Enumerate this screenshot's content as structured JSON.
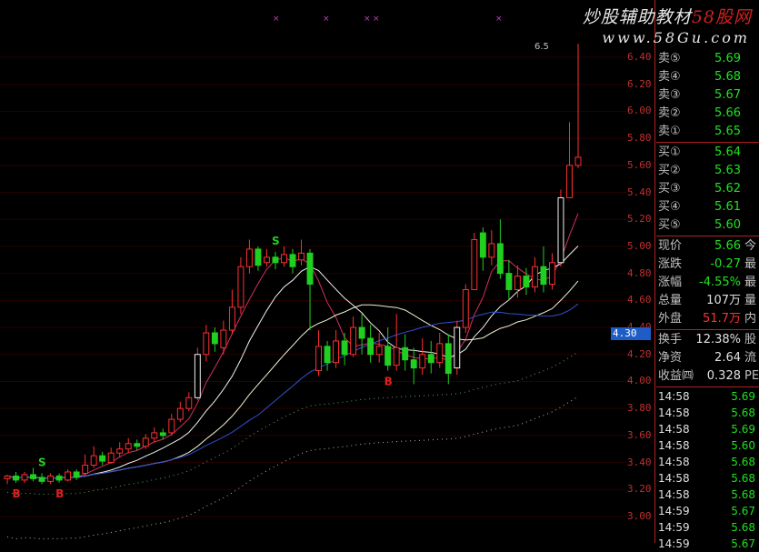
{
  "watermark": {
    "title_a": "炒股辅助教材",
    "title_b": "58股网",
    "url": "www.58Gu.com"
  },
  "peak_label": "6.5",
  "cursor_price": "4.30",
  "price_axis": [
    "6.40",
    "6.20",
    "6.00",
    "5.80",
    "5.60",
    "5.40",
    "5.20",
    "5.00",
    "4.80",
    "4.60",
    "4.40",
    "4.20",
    "4.00",
    "3.80",
    "3.60",
    "3.40",
    "3.20",
    "3.00"
  ],
  "order_book": [
    {
      "label": "卖⑤",
      "value": "5.69",
      "color": "green"
    },
    {
      "label": "卖④",
      "value": "5.68",
      "color": "green"
    },
    {
      "label": "卖③",
      "value": "5.67",
      "color": "green"
    },
    {
      "label": "卖②",
      "value": "5.66",
      "color": "green"
    },
    {
      "label": "卖①",
      "value": "5.65",
      "color": "green"
    },
    {
      "label": "买①",
      "value": "5.64",
      "color": "green"
    },
    {
      "label": "买②",
      "value": "5.63",
      "color": "green"
    },
    {
      "label": "买③",
      "value": "5.62",
      "color": "green"
    },
    {
      "label": "买④",
      "value": "5.61",
      "color": "green"
    },
    {
      "label": "买⑤",
      "value": "5.60",
      "color": "green"
    }
  ],
  "quote": [
    {
      "label": "现价",
      "value": "5.66",
      "color": "green",
      "cut": "今"
    },
    {
      "label": "涨跌",
      "value": "-0.27",
      "color": "green",
      "cut": "最"
    },
    {
      "label": "涨幅",
      "value": "-4.55%",
      "color": "green",
      "cut": "最"
    },
    {
      "label": "总量",
      "value": "107万",
      "color": "white",
      "cut": "量"
    },
    {
      "label": "外盘",
      "value": "51.7万",
      "color": "red",
      "cut": "内"
    }
  ],
  "stats": [
    {
      "label": "换手",
      "value": "12.38%",
      "color": "white",
      "cut": "股"
    },
    {
      "label": "净资",
      "value": "2.64",
      "color": "white",
      "cut": "流"
    },
    {
      "label": "收益㈣",
      "value": "0.328",
      "color": "white",
      "cut": "PE"
    }
  ],
  "ticks": [
    {
      "time": "14:58",
      "price": "5.69"
    },
    {
      "time": "14:58",
      "price": "5.68"
    },
    {
      "time": "14:58",
      "price": "5.69"
    },
    {
      "time": "14:58",
      "price": "5.60"
    },
    {
      "time": "14:58",
      "price": "5.68"
    },
    {
      "time": "14:58",
      "price": "5.68"
    },
    {
      "time": "14:58",
      "price": "5.68"
    },
    {
      "time": "14:59",
      "price": "5.67"
    },
    {
      "time": "14:59",
      "price": "5.68"
    },
    {
      "time": "14:59",
      "price": "5.67"
    }
  ],
  "signals": [
    {
      "text": "B",
      "color": "#e02020",
      "candle": 1
    },
    {
      "text": "S",
      "color": "#20d020",
      "candle": 4
    },
    {
      "text": "B",
      "color": "#e02020",
      "candle": 6
    },
    {
      "text": "S",
      "color": "#20d020",
      "candle": 31
    },
    {
      "text": "B",
      "color": "#e02020",
      "candle": 44
    }
  ],
  "chart_data": {
    "type": "candlestick",
    "ylim": [
      2.95,
      6.5
    ],
    "candles": [
      [
        3.28,
        3.3,
        3.24,
        3.31
      ],
      [
        3.3,
        3.27,
        3.25,
        3.33
      ],
      [
        3.27,
        3.31,
        3.25,
        3.33
      ],
      [
        3.31,
        3.28,
        3.26,
        3.36
      ],
      [
        3.29,
        3.26,
        3.24,
        3.32
      ],
      [
        3.26,
        3.3,
        3.24,
        3.32
      ],
      [
        3.3,
        3.27,
        3.25,
        3.32
      ],
      [
        3.27,
        3.33,
        3.26,
        3.35
      ],
      [
        3.33,
        3.29,
        3.27,
        3.35
      ],
      [
        3.32,
        3.38,
        3.3,
        3.46
      ],
      [
        3.38,
        3.45,
        3.36,
        3.52
      ],
      [
        3.45,
        3.41,
        3.38,
        3.48
      ],
      [
        3.4,
        3.47,
        3.39,
        3.51
      ],
      [
        3.47,
        3.5,
        3.44,
        3.55
      ],
      [
        3.5,
        3.54,
        3.47,
        3.58
      ],
      [
        3.54,
        3.52,
        3.49,
        3.57
      ],
      [
        3.52,
        3.58,
        3.5,
        3.61
      ],
      [
        3.58,
        3.62,
        3.55,
        3.66
      ],
      [
        3.62,
        3.6,
        3.57,
        3.65
      ],
      [
        3.62,
        3.72,
        3.6,
        3.76
      ],
      [
        3.72,
        3.8,
        3.7,
        3.85
      ],
      [
        3.8,
        3.88,
        3.78,
        3.92
      ],
      [
        3.88,
        4.2,
        3.86,
        4.25
      ],
      [
        4.2,
        4.36,
        4.15,
        4.42
      ],
      [
        4.36,
        4.28,
        4.22,
        4.4
      ],
      [
        4.25,
        4.38,
        4.2,
        4.45
      ],
      [
        4.38,
        4.55,
        4.35,
        4.68
      ],
      [
        4.55,
        4.85,
        4.5,
        4.92
      ],
      [
        4.85,
        4.98,
        4.8,
        5.05
      ],
      [
        4.98,
        4.86,
        4.82,
        5.0
      ],
      [
        4.88,
        4.92,
        4.85,
        4.98
      ],
      [
        4.92,
        4.88,
        4.83,
        4.96
      ],
      [
        4.88,
        4.94,
        4.85,
        5.0
      ],
      [
        4.94,
        4.85,
        4.8,
        4.98
      ],
      [
        4.9,
        4.95,
        4.86,
        5.05
      ],
      [
        4.95,
        4.72,
        4.38,
        4.98
      ],
      [
        4.08,
        4.26,
        4.04,
        4.38
      ],
      [
        4.26,
        4.14,
        4.08,
        4.3
      ],
      [
        4.14,
        4.3,
        4.1,
        4.38
      ],
      [
        4.3,
        4.2,
        4.12,
        4.36
      ],
      [
        4.2,
        4.4,
        4.18,
        4.48
      ],
      [
        4.4,
        4.32,
        4.2,
        4.5
      ],
      [
        4.32,
        4.2,
        4.14,
        4.42
      ],
      [
        4.2,
        4.26,
        4.14,
        4.36
      ],
      [
        4.26,
        4.12,
        4.08,
        4.4
      ],
      [
        4.12,
        4.25,
        4.08,
        4.5
      ],
      [
        4.25,
        4.16,
        4.08,
        4.35
      ],
      [
        4.16,
        4.1,
        3.98,
        4.25
      ],
      [
        4.1,
        4.2,
        4.05,
        4.32
      ],
      [
        4.2,
        4.14,
        4.06,
        4.3
      ],
      [
        4.14,
        4.28,
        4.1,
        4.36
      ],
      [
        4.28,
        4.06,
        3.98,
        4.35
      ],
      [
        4.1,
        4.4,
        4.05,
        4.45
      ],
      [
        4.4,
        4.68,
        4.36,
        4.72
      ],
      [
        4.68,
        5.05,
        4.8,
        5.1
      ],
      [
        5.1,
        4.92,
        4.82,
        5.14
      ],
      [
        4.92,
        5.02,
        4.86,
        5.12
      ],
      [
        5.02,
        4.8,
        4.76,
        5.2
      ],
      [
        4.8,
        4.68,
        4.6,
        4.9
      ],
      [
        4.68,
        4.78,
        4.62,
        4.86
      ],
      [
        4.78,
        4.7,
        4.64,
        4.84
      ],
      [
        4.7,
        4.85,
        4.66,
        4.92
      ],
      [
        4.85,
        4.72,
        4.66,
        5.0
      ],
      [
        4.72,
        4.88,
        4.68,
        4.95
      ],
      [
        4.88,
        5.36,
        4.85,
        5.42
      ],
      [
        5.36,
        5.6,
        5.46,
        5.92
      ],
      [
        5.6,
        5.66,
        5.58,
        6.5
      ]
    ]
  }
}
